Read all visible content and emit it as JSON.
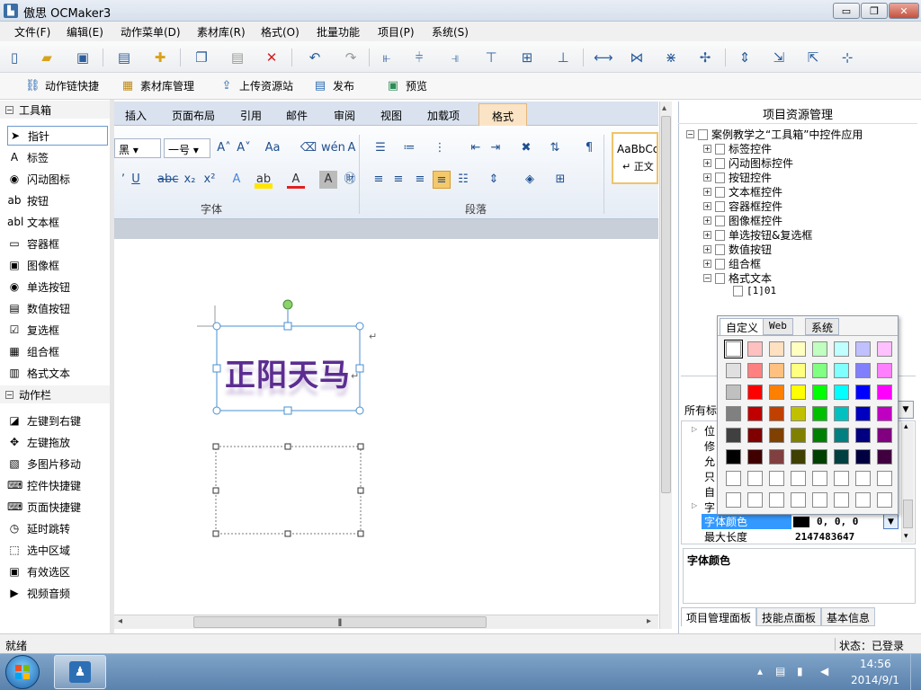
{
  "window": {
    "title": "傲思 OCMaker3",
    "app_icon": "▙"
  },
  "window_controls": {
    "minimize": "▭",
    "restore": "❐",
    "close": "✕"
  },
  "menu": [
    "文件(F)",
    "编辑(E)",
    "动作菜单(D)",
    "素材库(R)",
    "格式(O)",
    "批量功能",
    "项目(P)",
    "系统(S)"
  ],
  "toolbar2": [
    {
      "label": "动作链快捷",
      "icon": "chain-icon"
    },
    {
      "label": "素材库管理",
      "icon": "library-icon"
    },
    {
      "label": "上传资源站",
      "icon": "upload-icon"
    },
    {
      "label": "发布",
      "icon": "publish-icon"
    },
    {
      "label": "预览",
      "icon": "preview-icon"
    }
  ],
  "toolbox": {
    "section1": "工具箱",
    "tools": [
      {
        "label": "指针",
        "icon": "pointer-icon",
        "glyph": "➤"
      },
      {
        "label": "标签",
        "icon": "label-icon",
        "glyph": "A"
      },
      {
        "label": "闪动图标",
        "icon": "flash-icon-icon",
        "glyph": "◉"
      },
      {
        "label": "按钮",
        "icon": "button-icon",
        "glyph": "ab"
      },
      {
        "label": "文本框",
        "icon": "textbox-icon",
        "glyph": "abl"
      },
      {
        "label": "容器框",
        "icon": "container-icon",
        "glyph": "▭"
      },
      {
        "label": "图像框",
        "icon": "image-icon",
        "glyph": "▣"
      },
      {
        "label": "单选按钮",
        "icon": "radio-icon",
        "glyph": "◉"
      },
      {
        "label": "数值按钮",
        "icon": "spinner-icon",
        "glyph": "▤"
      },
      {
        "label": "复选框",
        "icon": "checkbox-icon",
        "glyph": "☑"
      },
      {
        "label": "组合框",
        "icon": "combobox-icon",
        "glyph": "▦"
      },
      {
        "label": "格式文本",
        "icon": "richtext-icon",
        "glyph": "▥"
      }
    ],
    "section2": "动作栏",
    "actions": [
      {
        "label": "左键到右键",
        "icon": "mouse-icon",
        "glyph": "◪"
      },
      {
        "label": "左键拖放",
        "icon": "drag-icon",
        "glyph": "✥"
      },
      {
        "label": "多图片移动",
        "icon": "multi-image-icon",
        "glyph": "▧"
      },
      {
        "label": "控件快捷键",
        "icon": "control-key-icon",
        "glyph": "⌨"
      },
      {
        "label": "页面快捷键",
        "icon": "page-key-icon",
        "glyph": "⌨"
      },
      {
        "label": "延时跳转",
        "icon": "timer-icon",
        "glyph": "◷"
      },
      {
        "label": "选中区域",
        "icon": "select-area-icon",
        "glyph": "⬚"
      },
      {
        "label": "有效选区",
        "icon": "valid-area-icon",
        "glyph": "▣"
      },
      {
        "label": "视频音频",
        "icon": "media-icon",
        "glyph": "▶"
      }
    ]
  },
  "ribbon": {
    "tabs": [
      "插入",
      "页面布局",
      "引用",
      "邮件",
      "审阅",
      "视图",
      "加载项",
      "格式"
    ],
    "font_name": "黑",
    "font_size": "一号",
    "group_font": "字体",
    "group_paragraph": "段落",
    "style_preview": "AaBbCcI",
    "style_name": "↵ 正文"
  },
  "canvas": {
    "text": "正阳天马",
    "return_mark": "↵"
  },
  "project_panel": {
    "title": "项目资源管理",
    "root": "案例教学之“工具箱”中控件应用",
    "items": [
      "标签控件",
      "闪动图标控件",
      "按钮控件",
      "文本框控件",
      "容器框控件",
      "图像框控件",
      "单选按钮&复选框",
      "数值按钮",
      "组合框",
      "格式文本"
    ],
    "child": "[1]01"
  },
  "properties": {
    "category_label": "所有标",
    "rows_partial": [
      "位",
      "修",
      "允",
      "只",
      "自",
      "字"
    ],
    "font_color_label": "字体颜色",
    "font_color_value": "0,  0,  0",
    "max_length_label": "最大长度",
    "max_length_value": "2147483647",
    "description_title": "字体颜色"
  },
  "color_picker": {
    "tabs": [
      "自定义",
      "Web",
      "系统"
    ],
    "rows": [
      [
        "#ffffff",
        "#ffc0c0",
        "#ffe0c0",
        "#ffffc0",
        "#c0ffc0",
        "#c0ffff",
        "#c0c0ff",
        "#ffc0ff"
      ],
      [
        "#e0e0e0",
        "#ff8080",
        "#ffc080",
        "#ffff80",
        "#80ff80",
        "#80ffff",
        "#8080ff",
        "#ff80ff"
      ],
      [
        "#c0c0c0",
        "#ff0000",
        "#ff8000",
        "#ffff00",
        "#00ff00",
        "#00ffff",
        "#0000ff",
        "#ff00ff"
      ],
      [
        "#808080",
        "#c00000",
        "#c04000",
        "#c0c000",
        "#00c000",
        "#00c0c0",
        "#0000c0",
        "#c000c0"
      ],
      [
        "#404040",
        "#800000",
        "#804000",
        "#808000",
        "#008000",
        "#008080",
        "#000080",
        "#800080"
      ],
      [
        "#000000",
        "#400000",
        "#804040",
        "#404000",
        "#004000",
        "#004040",
        "#000040",
        "#400040"
      ],
      [
        "#ffffff",
        "#ffffff",
        "#ffffff",
        "#ffffff",
        "#ffffff",
        "#ffffff",
        "#ffffff",
        "#ffffff"
      ],
      [
        "#ffffff",
        "#ffffff",
        "#ffffff",
        "#ffffff",
        "#ffffff",
        "#ffffff",
        "#ffffff",
        "#ffffff"
      ]
    ]
  },
  "panel_tabs": [
    "项目管理面板",
    "技能点面板",
    "基本信息"
  ],
  "status": {
    "left": "就绪",
    "right": "状态：已登录"
  },
  "taskbar": {
    "time": "14:56",
    "date": "2014/9/1"
  }
}
